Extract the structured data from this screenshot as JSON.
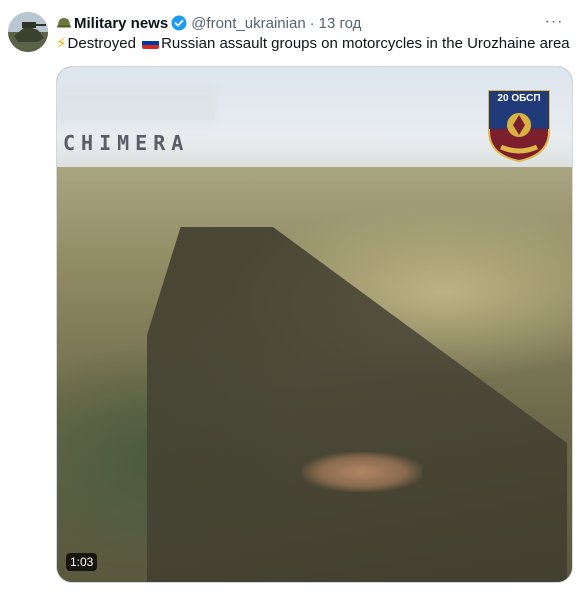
{
  "tweet": {
    "avatar_icon": "channel-avatar-icon",
    "helmet_icon": "helmet-icon",
    "display_name": "Military news",
    "verified_icon": "verified-badge-icon",
    "handle": "@front_ukrainian",
    "separator": "·",
    "time": "13 год",
    "more_icon": "more-icon",
    "more_glyph": "···",
    "text": {
      "bolt_glyph": "⚡",
      "part1": "Destroyed ",
      "flag_icon": "russia-flag-icon",
      "part2": "Russian assault groups on motorcycles in the Urozhaine area"
    },
    "media": {
      "watermark": "CHIMERA",
      "emblem_text": "20 ОБСП",
      "emblem_icon": "unit-emblem-icon",
      "emblem_ribbon": "УКРАЇНА",
      "duration": "1:03"
    }
  },
  "colors": {
    "text_primary": "#0f1419",
    "text_secondary": "#536471",
    "verified_blue": "#1d9bf0",
    "border": "#cfd9de"
  }
}
